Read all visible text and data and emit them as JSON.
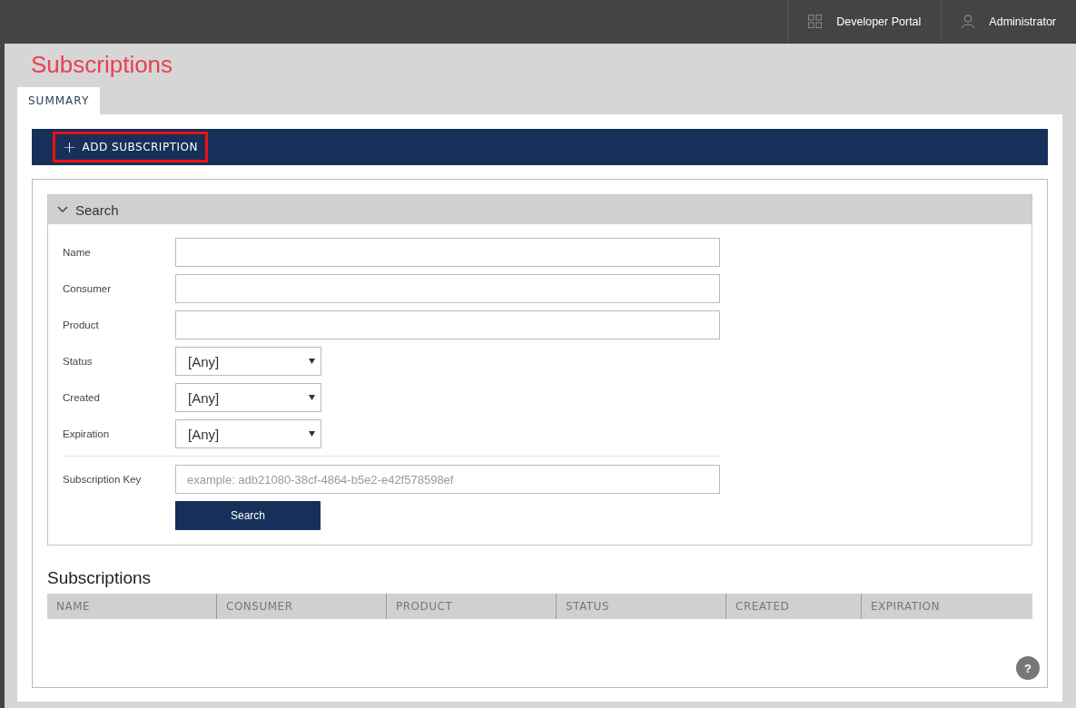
{
  "top_bar": {
    "items": [
      {
        "kind": "grid",
        "label": "Developer Portal"
      },
      {
        "kind": "user",
        "label": "Administrator"
      }
    ]
  },
  "page_title": "Subscriptions",
  "tabs": [
    {
      "label": "SUMMARY",
      "selected": true
    }
  ],
  "toolbar": {
    "add_button": {
      "icon": "+",
      "label": "ADD SUBSCRIPTION",
      "highlighted": true
    }
  },
  "search": {
    "title": "Search",
    "expanded": true,
    "fields": [
      {
        "kind": "text",
        "label": "Name"
      },
      {
        "kind": "text",
        "label": "Consumer"
      },
      {
        "kind": "text",
        "label": "Product"
      },
      {
        "kind": "select",
        "label": "Status",
        "value": "[Any]"
      },
      {
        "kind": "select",
        "label": "Created",
        "value": "[Any]"
      },
      {
        "kind": "select",
        "label": "Expiration",
        "value": "[Any]"
      },
      {
        "kind": "divider"
      },
      {
        "kind": "text",
        "label": "Subscription Key",
        "placeholder": "example: adb21080-38cf-4864-b5e2-e42f578598ef"
      }
    ],
    "button": "Search"
  },
  "results": {
    "title": "Subscriptions",
    "columns": [
      "NAME",
      "CONSUMER",
      "PRODUCT",
      "STATUS",
      "CREATED",
      "EXPIRATION"
    ]
  },
  "help_button": "?"
}
